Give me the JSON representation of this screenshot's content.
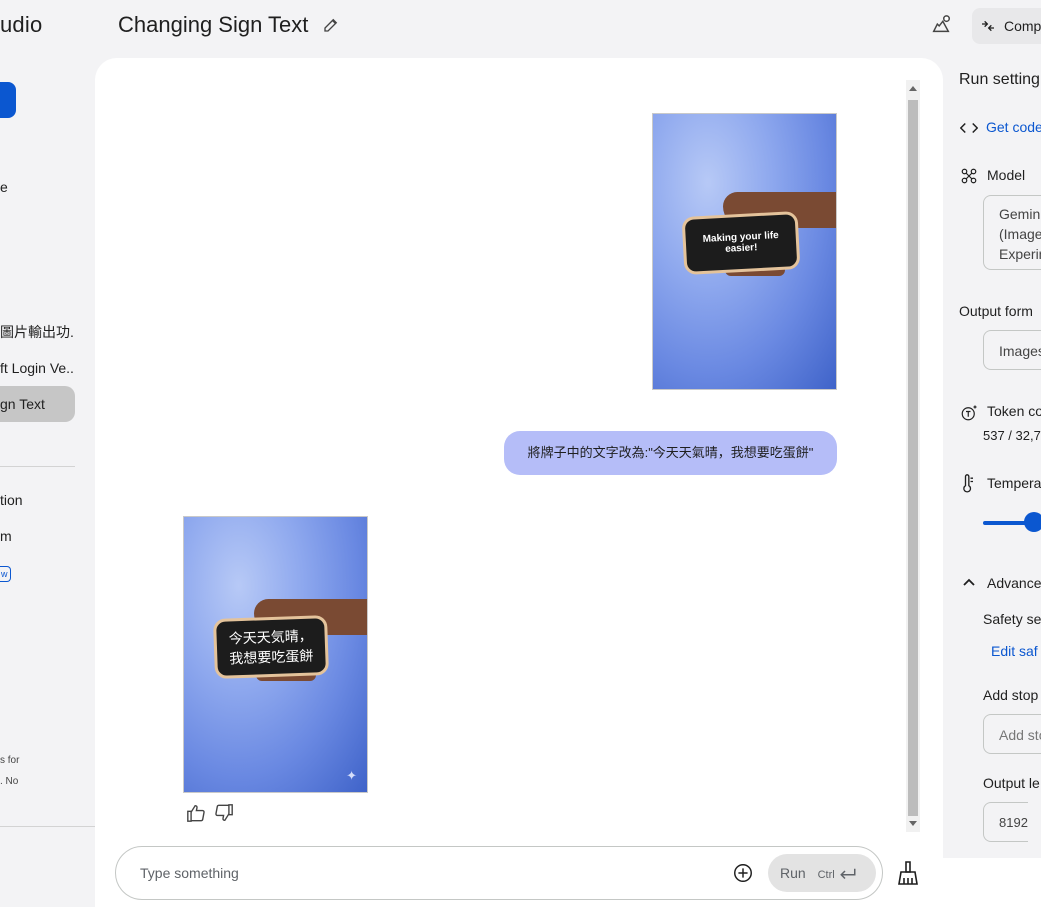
{
  "sidebar": {
    "brand": "udio",
    "item_e": "e",
    "history": [
      {
        "label": "圖片輸出功..."
      },
      {
        "label": "ft Login Ve..."
      },
      {
        "label": "gn Text"
      }
    ],
    "item_tion": "tion",
    "item_m": "m",
    "badge": "w",
    "note_line1": "s for",
    "note_line2": ". No"
  },
  "header": {
    "title": "Changing Sign Text",
    "compare_label": "Comp"
  },
  "chat": {
    "image1_sign_text": "Making your life easier!",
    "user_message": "將牌子中的文字改為:\"今天天氣晴，我想要吃蛋餅\"",
    "image2_sign_line1": "今天天気晴，",
    "image2_sign_line2": "我想要吃蛋餅",
    "sparkle": "✦"
  },
  "input": {
    "placeholder": "Type something",
    "run_label": "Run",
    "shortcut": "Ctrl"
  },
  "run_settings": {
    "title": "Run setting",
    "get_code": "Get code",
    "model_label": "Model",
    "model_value_line1": "Gemini",
    "model_value_line2": "(Image",
    "model_value_line3": "Experin",
    "output_format_label": "Output form",
    "output_format_value": "Images",
    "token_label": "Token co",
    "token_value": "537 / 32,7",
    "temperature_label": "Tempera",
    "advanced_label": "Advance",
    "safety_label": "Safety se",
    "edit_safety": "Edit saf",
    "stop_label": "Add stop",
    "stop_placeholder": "Add sto",
    "output_length_label": "Output le",
    "output_length_value": "8192"
  }
}
